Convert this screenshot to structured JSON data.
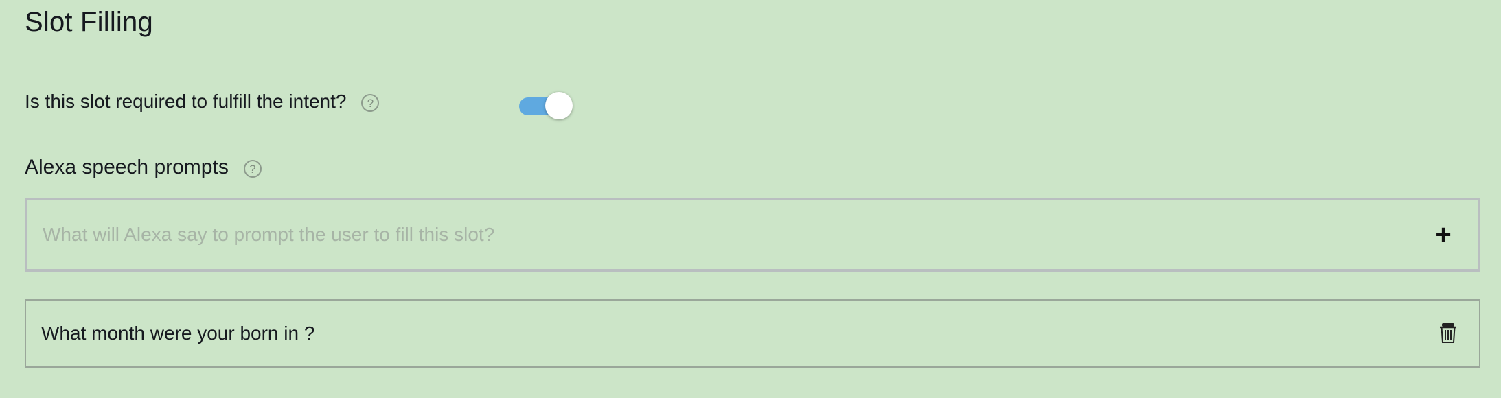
{
  "section": {
    "title": "Slot Filling"
  },
  "required": {
    "label": "Is this slot required to fulfill the intent?",
    "help_glyph": "?",
    "toggle_on": true,
    "toggle_color": "#5fa9e0"
  },
  "prompts": {
    "label": "Alexa speech prompts",
    "help_glyph": "?",
    "input": {
      "placeholder": "What will Alexa say to prompt the user to fill this slot?",
      "value": ""
    },
    "add_glyph": "+",
    "items": [
      {
        "text": "What month were your born in ?",
        "delete_icon": "trash-icon"
      }
    ]
  },
  "colors": {
    "background": "#cce5c8",
    "input_border": "#b9bec0",
    "item_border": "#9aa79a"
  }
}
